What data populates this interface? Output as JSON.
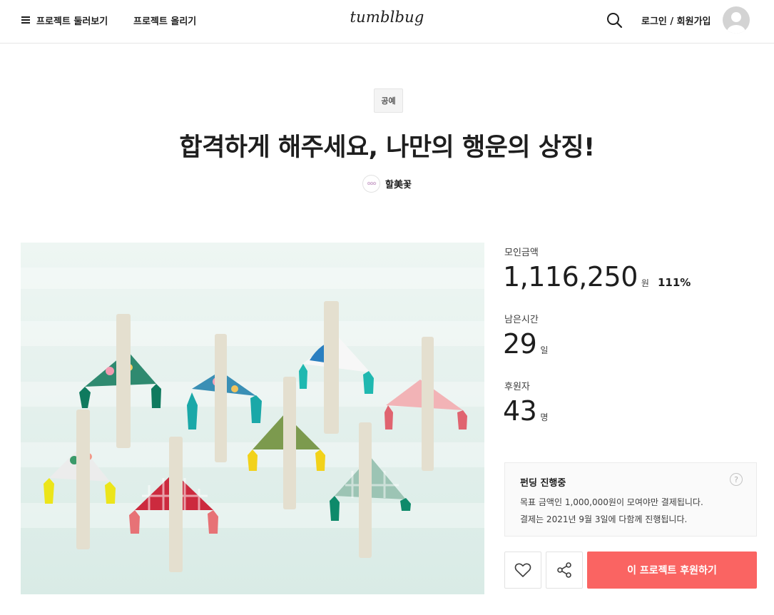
{
  "header": {
    "browse_label": "프로젝트 둘러보기",
    "upload_label": "프로젝트 올리기",
    "logo": "tumblbug",
    "login_label": "로그인 / 회원가입"
  },
  "project": {
    "category": "공예",
    "title": "합격하게 해주세요, 나만의 행운의 상징!",
    "creator_name": "할美꽃"
  },
  "stats": {
    "raised_label": "모인금액",
    "raised_value": "1,116,250",
    "raised_unit": "원",
    "raised_percent": "111%",
    "time_label": "남은시간",
    "time_value": "29",
    "time_unit": "일",
    "backers_label": "후원자",
    "backers_value": "43",
    "backers_unit": "명"
  },
  "funding_box": {
    "title": "펀딩 진행중",
    "help": "?",
    "line1": "목표 금액인 1,000,000원이 모여야만 결제됩니다.",
    "line2": "결제는 2021년 9월 3일에 다함께 진행됩니다."
  },
  "actions": {
    "back_label": "이 프로젝트 후원하기"
  },
  "colors": {
    "accent": "#fa6462",
    "text": "#1e1e1e",
    "border": "#e6e6e6"
  },
  "icons": [
    "hamburger-icon",
    "search-icon",
    "user-avatar-icon",
    "heart-icon",
    "share-icon",
    "question-icon"
  ]
}
